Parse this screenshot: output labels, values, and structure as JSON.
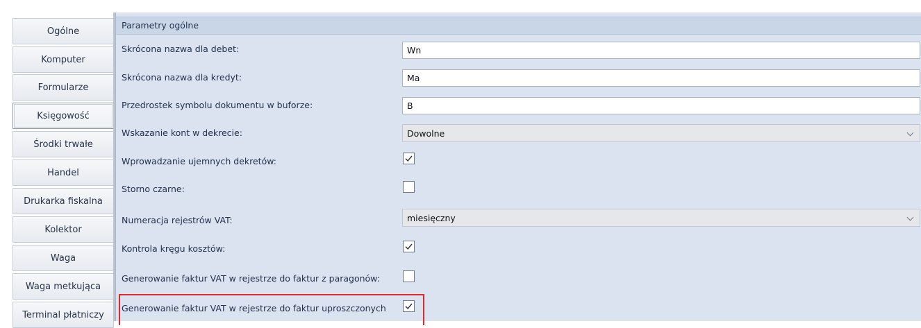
{
  "nav": {
    "items": [
      {
        "label": "Ogólne"
      },
      {
        "label": "Komputer"
      },
      {
        "label": "Formularze"
      },
      {
        "label": "Księgowość",
        "active": true
      },
      {
        "label": "Środki trwałe"
      },
      {
        "label": "Handel"
      },
      {
        "label": "Drukarka fiskalna"
      },
      {
        "label": "Kolektor"
      },
      {
        "label": "Waga"
      },
      {
        "label": "Waga metkująca"
      },
      {
        "label": "Terminal płatniczy"
      }
    ]
  },
  "group": {
    "title": "Parametry ogólne",
    "rows": [
      {
        "label": "Skrócona nazwa dla debet:",
        "type": "text",
        "value": "Wn"
      },
      {
        "label": "Skrócona nazwa dla kredyt:",
        "type": "text",
        "value": "Ma"
      },
      {
        "label": "Przedrostek symbolu dokumentu w buforze:",
        "type": "text",
        "value": "B"
      },
      {
        "label": "Wskazanie kont w dekrecie:",
        "type": "select",
        "value": "Dowolne"
      },
      {
        "label": "Wprowadzanie ujemnych dekretów:",
        "type": "checkbox",
        "checked": true
      },
      {
        "label": "Storno czarne:",
        "type": "checkbox",
        "checked": false
      },
      {
        "label": "Numeracja rejestrów VAT:",
        "type": "select",
        "value": "miesięczny"
      },
      {
        "label": "Kontrola kręgu kosztów:",
        "type": "checkbox",
        "checked": true
      },
      {
        "label": "Generowanie faktur VAT w rejestrze do faktur z paragonów:",
        "type": "checkbox",
        "checked": false
      },
      {
        "label": "Generowanie faktur VAT w rejestrze do faktur uproszczonych",
        "type": "checkbox",
        "checked": true,
        "highlighted": true
      }
    ]
  },
  "colors": {
    "highlight": "#e3282c",
    "panel_bg": "#dae3ef",
    "header_bg": "#c9d6e8"
  }
}
